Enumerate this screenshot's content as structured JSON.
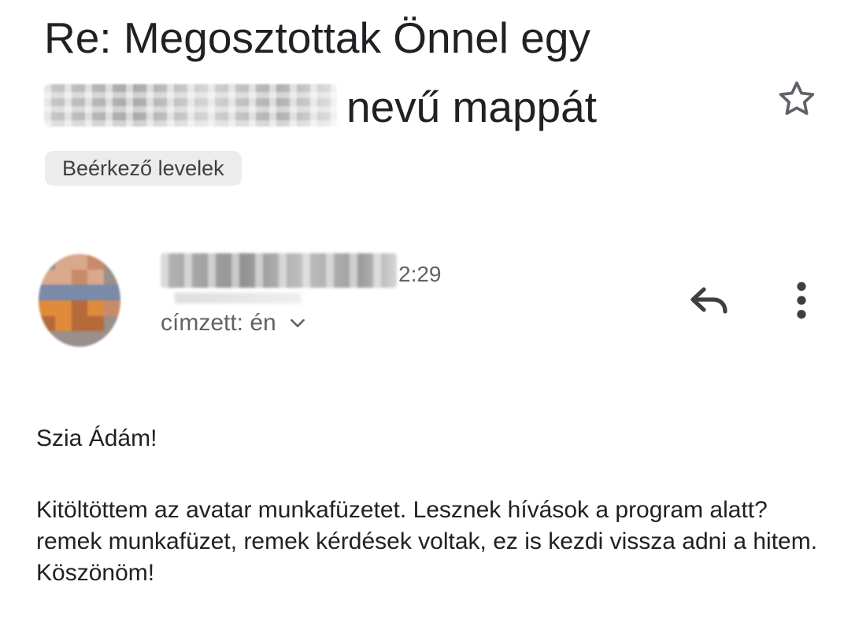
{
  "email": {
    "subject_prefix": "Re: Megosztottak Önnel egy",
    "subject_suffix": "nevű mappát",
    "label": "Beérkező levelek",
    "time": "2:29",
    "recipients": "címzett: én",
    "greeting": "Szia Ádám!",
    "body": "Kitöltöttem az avatar munkafüzetet. Lesznek hívások a program alatt? remek munkafüzet, remek kérdések voltak, ez is kezdi vissza adni a hitem. Köszönöm!"
  },
  "icons": {
    "star": "star-outline-icon",
    "reply": "reply-icon",
    "more": "more-vertical-icon",
    "expand": "chevron-down-icon"
  },
  "colors": {
    "text_primary": "#202124",
    "text_secondary": "#5f6368",
    "chip_bg": "#ececec",
    "avatar_palette": [
      "#d9a98c",
      "#c98a6b",
      "#7a8aa8",
      "#e08a3c",
      "#b56a3a",
      "#9a8f8a"
    ]
  }
}
